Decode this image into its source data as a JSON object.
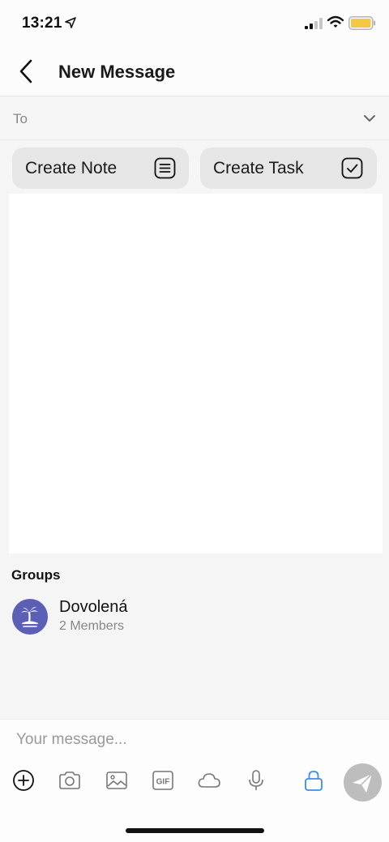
{
  "status_bar": {
    "time": "13:21",
    "icons": [
      "location-arrow-icon",
      "cellular-signal-icon",
      "wifi-icon",
      "battery-icon"
    ],
    "battery_color": "#f5c842"
  },
  "nav": {
    "title": "New Message",
    "back_icon": "chevron-left-icon"
  },
  "to_field": {
    "label": "To",
    "chevron_icon": "chevron-down-icon"
  },
  "quick_actions": [
    {
      "label": "Create Note",
      "icon": "note-lines-icon"
    },
    {
      "label": "Create Task",
      "icon": "checkbox-icon"
    }
  ],
  "groups": {
    "heading": "Groups",
    "items": [
      {
        "name": "Dovolená",
        "members": "2 Members",
        "avatar_icon": "palm-island-icon",
        "avatar_color": "#5b5fb5"
      }
    ]
  },
  "composer": {
    "placeholder": "Your message...",
    "tools": [
      "plus-circle-icon",
      "camera-icon",
      "image-icon",
      "gif-icon",
      "cloud-icon",
      "microphone-icon",
      "lock-icon"
    ],
    "lock_color": "#3a8ee6",
    "send_icon": "paper-plane-icon",
    "send_bg": "#bdbdbd"
  }
}
